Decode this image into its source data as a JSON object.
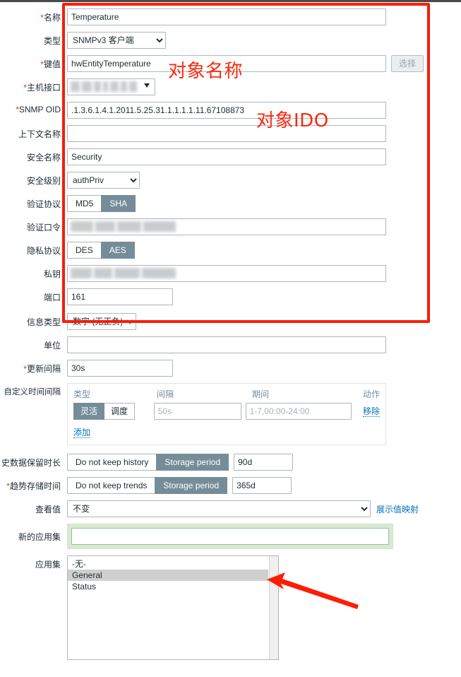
{
  "form": {
    "rows": {
      "name": {
        "label": "名称",
        "required": true,
        "value": "Temperature"
      },
      "type": {
        "label": "类型",
        "required": false,
        "value": "SNMPv3 客户端"
      },
      "key": {
        "label": "键值",
        "required": true,
        "value": "hwEntityTemperature",
        "button": "选择"
      },
      "host_iface": {
        "label": "主机接口",
        "required": true,
        "value": ""
      },
      "snmp_oid": {
        "label": "SNMP OID",
        "required": true,
        "value": ".1.3.6.1.4.1.2011.5.25.31.1.1.1.1.11.67108873"
      },
      "context": {
        "label": "上下文名称",
        "required": false,
        "value": ""
      },
      "sec_name": {
        "label": "安全名称",
        "required": false,
        "value": "Security"
      },
      "sec_level": {
        "label": "安全级别",
        "required": false,
        "value": "authPriv"
      },
      "auth_proto": {
        "label": "验证协议",
        "required": false,
        "options": [
          "MD5",
          "SHA"
        ],
        "selected": "SHA"
      },
      "auth_pass": {
        "label": "验证口令",
        "required": false,
        "value": ""
      },
      "priv_proto": {
        "label": "隐私协议",
        "required": false,
        "options": [
          "DES",
          "AES"
        ],
        "selected": "AES"
      },
      "priv_key": {
        "label": "私钥",
        "required": false,
        "value": ""
      },
      "port": {
        "label": "端口",
        "required": false,
        "value": "161"
      },
      "info_type": {
        "label": "信息类型",
        "required": false,
        "value": "数字 (无正负)"
      },
      "units": {
        "label": "单位",
        "required": false,
        "value": ""
      },
      "update_int": {
        "label": "更新间隔",
        "required": true,
        "value": "30s"
      },
      "custom_int": {
        "label": "自定义时间间隔"
      },
      "history": {
        "label": "史数据保留时长",
        "required": false,
        "options": [
          "Do not keep history",
          "Storage period"
        ],
        "selected": "Storage period",
        "value": "90d"
      },
      "trends": {
        "label": "趋势存储时间",
        "required": true,
        "options": [
          "Do not keep trends",
          "Storage period"
        ],
        "selected": "Storage period",
        "value": "365d"
      },
      "view_value": {
        "label": "查看值",
        "required": false,
        "value": "不变",
        "link": "展示值映射"
      },
      "new_appset": {
        "label": "新的应用集",
        "required": false,
        "value": "",
        "placeholder": ""
      },
      "appset": {
        "label": "应用集",
        "required": false,
        "items": [
          "-无-",
          "General",
          "Status"
        ],
        "selected": "General"
      }
    },
    "custom_intervals": {
      "headers": {
        "type": "类型",
        "interval": "间隔",
        "period": "期间",
        "action": "动作"
      },
      "row": {
        "type_options": [
          "灵活",
          "调度"
        ],
        "type_selected": "灵活",
        "interval_placeholder": "50s",
        "period_placeholder": "1-7,00:00-24:00",
        "remove_label": "移除"
      },
      "add_label": "添加"
    }
  },
  "annotations": {
    "object_name": "对象名称",
    "object_oid": "对象IDO",
    "box_color": "#f91d06",
    "arrow_color": "#fc1d06"
  }
}
